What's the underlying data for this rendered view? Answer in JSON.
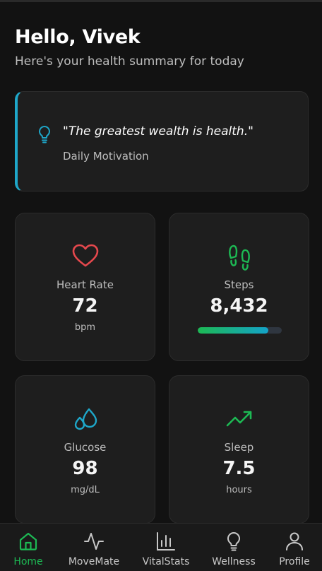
{
  "header": {
    "greeting": "Hello, Vivek",
    "subtitle": "Here's your health summary for today"
  },
  "motivation": {
    "quote": "\"The greatest wealth is health.\"",
    "caption": "Daily Motivation",
    "icon": "lightbulb-icon",
    "accent_color": "#1ea7c9"
  },
  "stats": {
    "heart_rate": {
      "label": "Heart Rate",
      "value": "72",
      "unit": "bpm",
      "icon": "heart-icon",
      "color": "#e5484d"
    },
    "steps": {
      "label": "Steps",
      "value": "8,432",
      "icon": "footprints-icon",
      "color": "#1db954",
      "progress": 0.84
    },
    "glucose": {
      "label": "Glucose",
      "value": "98",
      "unit": "mg/dL",
      "icon": "droplets-icon",
      "color": "#1ea7c9"
    },
    "sleep": {
      "label": "Sleep",
      "value": "7.5",
      "unit": "hours",
      "icon": "trending-up-icon",
      "color": "#1db954"
    }
  },
  "nav": {
    "active": "home",
    "active_color": "#1db954",
    "items": [
      {
        "label": "Home",
        "icon": "home-icon"
      },
      {
        "label": "MoveMate",
        "icon": "activity-icon"
      },
      {
        "label": "VitalStats",
        "icon": "bar-chart-icon"
      },
      {
        "label": "Wellness",
        "icon": "lightbulb-icon"
      },
      {
        "label": "Profile",
        "icon": "user-icon"
      }
    ]
  }
}
